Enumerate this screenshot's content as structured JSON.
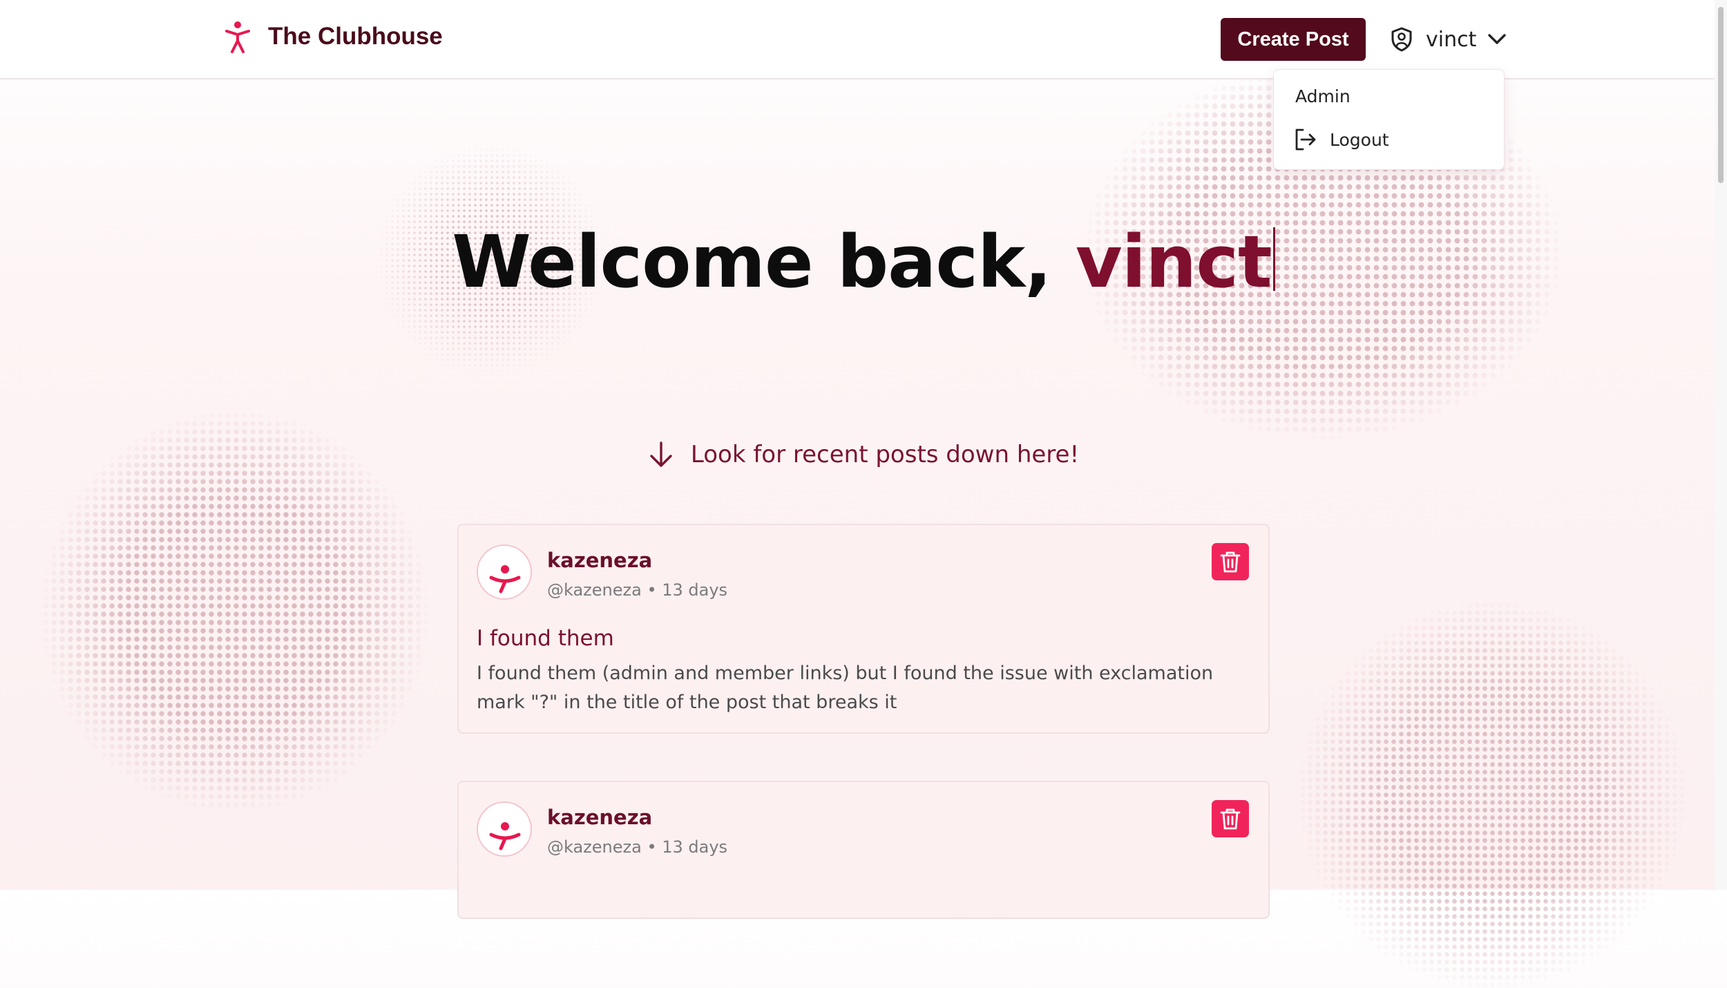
{
  "app": {
    "name": "The Clubhouse"
  },
  "header": {
    "create_post_label": "Create Post",
    "username": "vinct"
  },
  "user_menu": {
    "items": [
      {
        "label": "Admin"
      },
      {
        "label": "Logout"
      }
    ]
  },
  "hero": {
    "greeting": "Welcome back,",
    "username": "vinct"
  },
  "feed_hint": "Look for recent posts down here!",
  "posts": [
    {
      "author": "kazeneza",
      "meta": "@kazeneza • 13 days",
      "title": "I found them",
      "body": "I found them (admin and member links) but I found the issue with exclamation mark \"?\" in the title of the post that breaks it"
    },
    {
      "author": "kazeneza",
      "meta": "@kazeneza • 13 days"
    }
  ],
  "colors": {
    "brand_dark": "#520a1c",
    "accent_red": "#f0245a",
    "accent_text": "#7f0f2e"
  },
  "icons": {
    "brand": "person-figure-icon",
    "user": "shield-user-icon",
    "chevron": "chevron-down-icon",
    "logout": "logout-icon",
    "hint": "arrow-down-icon",
    "delete": "trash-icon"
  }
}
